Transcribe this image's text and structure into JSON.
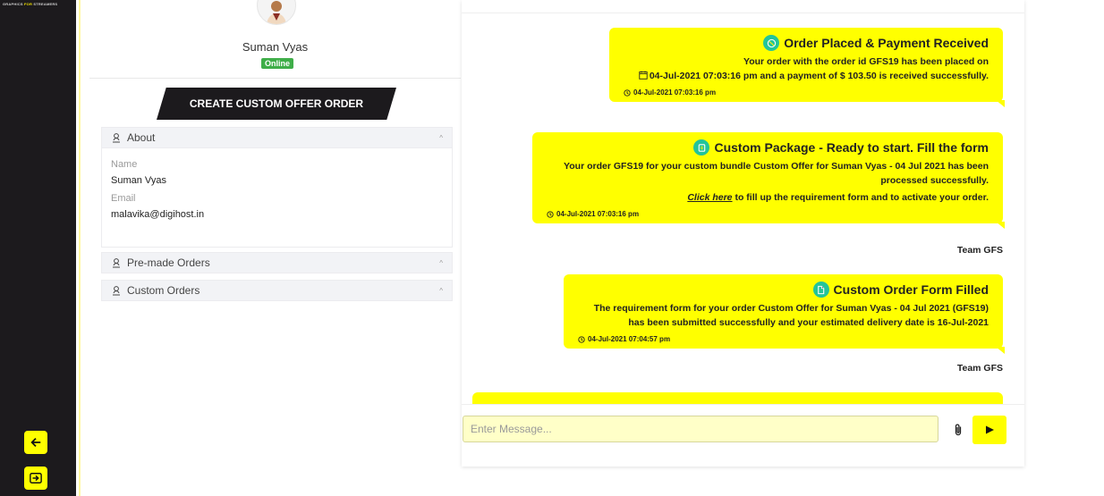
{
  "brand": {
    "part1": "GRAPHICS ",
    "part2": "FOR",
    "part3": " STREAMERS"
  },
  "profile": {
    "name": "Suman Vyas",
    "status": "Online",
    "create_button": "CREATE CUSTOM OFFER ORDER",
    "about": {
      "title": "About",
      "name_label": "Name",
      "name_value": "Suman Vyas",
      "email_label": "Email",
      "email_value": "malavika@digihost.in"
    },
    "premade_title": "Pre-made Orders",
    "custom_title": "Custom Orders"
  },
  "messages": {
    "m1": {
      "title": "Order Placed & Payment Received",
      "line1": "Your order with the order id GFS19 has been placed on",
      "line2": "04-Jul-2021 07:03:16 pm and a payment of $ 103.50 is received successfully.",
      "time": "04-Jul-2021 07:03:16 pm"
    },
    "m2": {
      "title": "Custom Package - Ready to start. Fill the form",
      "line1": "Your order GFS19 for your custom bundle Custom Offer for Suman Vyas - 04 Jul 2021 has been",
      "line2": "processed successfully.",
      "link": "Click here",
      "line3": " to fill up the requirement form and to activate your order.",
      "time": "04-Jul-2021 07:03:16 pm",
      "signature": "Team GFS"
    },
    "m3": {
      "title": "Custom Order Form Filled",
      "line1": "The requirement form for your order Custom Offer for Suman Vyas - 04 Jul 2021 (GFS19)",
      "line2": "has been submitted successfully and your estimated delivery date is 16-Jul-2021",
      "time": "04-Jul-2021 07:04:57 pm",
      "signature": "Team GFS"
    }
  },
  "composer": {
    "placeholder": "Enter Message..."
  },
  "colors": {
    "accent": "#ffff00",
    "dark": "#1c1a1d",
    "online": "#3fae49",
    "icon_badge": "#23c49a"
  },
  "icons": [
    "back-arrow-icon",
    "sign-out-icon",
    "user-icon",
    "chevron-up-icon",
    "paperclip-icon",
    "send-icon",
    "calendar-icon",
    "clock-icon"
  ]
}
